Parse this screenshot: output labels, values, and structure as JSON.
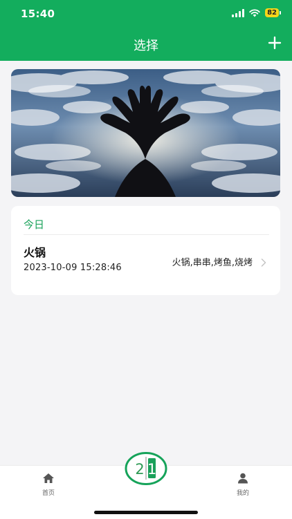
{
  "status_bar": {
    "time": "15:40",
    "battery_level": "82",
    "icons": [
      "signal-icon",
      "wifi-icon",
      "battery-icon"
    ]
  },
  "nav": {
    "title": "选择",
    "add_icon": "plus-icon"
  },
  "banner": {
    "image": "sky-hands-photo"
  },
  "section": {
    "title": "今日",
    "records": [
      {
        "title": "火锅",
        "time": "2023-10-09 15:28:46",
        "tags": "火锅,串串,烤鱼,烧烤"
      }
    ]
  },
  "tabbar": {
    "home_label": "首页",
    "mine_label": "我的",
    "center_digit_1": "2",
    "center_digit_2": "1"
  },
  "colors": {
    "primary": "#13ad5d",
    "section_title": "#19a25a",
    "background": "#f4f4f6",
    "battery": "#f6d51a"
  }
}
